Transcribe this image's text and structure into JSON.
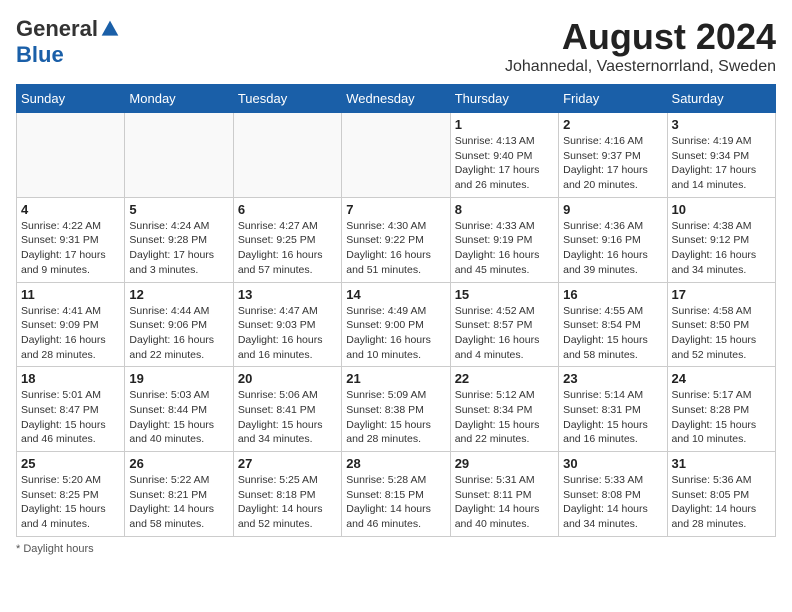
{
  "logo": {
    "general": "General",
    "blue": "Blue"
  },
  "title": {
    "month_year": "August 2024",
    "location": "Johannedal, Vaesternorrland, Sweden"
  },
  "days_of_week": [
    "Sunday",
    "Monday",
    "Tuesday",
    "Wednesday",
    "Thursday",
    "Friday",
    "Saturday"
  ],
  "weeks": [
    {
      "days": [
        {
          "num": "",
          "info": ""
        },
        {
          "num": "",
          "info": ""
        },
        {
          "num": "",
          "info": ""
        },
        {
          "num": "",
          "info": ""
        },
        {
          "num": "1",
          "info": "Sunrise: 4:13 AM\nSunset: 9:40 PM\nDaylight: 17 hours\nand 26 minutes."
        },
        {
          "num": "2",
          "info": "Sunrise: 4:16 AM\nSunset: 9:37 PM\nDaylight: 17 hours\nand 20 minutes."
        },
        {
          "num": "3",
          "info": "Sunrise: 4:19 AM\nSunset: 9:34 PM\nDaylight: 17 hours\nand 14 minutes."
        }
      ]
    },
    {
      "days": [
        {
          "num": "4",
          "info": "Sunrise: 4:22 AM\nSunset: 9:31 PM\nDaylight: 17 hours\nand 9 minutes."
        },
        {
          "num": "5",
          "info": "Sunrise: 4:24 AM\nSunset: 9:28 PM\nDaylight: 17 hours\nand 3 minutes."
        },
        {
          "num": "6",
          "info": "Sunrise: 4:27 AM\nSunset: 9:25 PM\nDaylight: 16 hours\nand 57 minutes."
        },
        {
          "num": "7",
          "info": "Sunrise: 4:30 AM\nSunset: 9:22 PM\nDaylight: 16 hours\nand 51 minutes."
        },
        {
          "num": "8",
          "info": "Sunrise: 4:33 AM\nSunset: 9:19 PM\nDaylight: 16 hours\nand 45 minutes."
        },
        {
          "num": "9",
          "info": "Sunrise: 4:36 AM\nSunset: 9:16 PM\nDaylight: 16 hours\nand 39 minutes."
        },
        {
          "num": "10",
          "info": "Sunrise: 4:38 AM\nSunset: 9:12 PM\nDaylight: 16 hours\nand 34 minutes."
        }
      ]
    },
    {
      "days": [
        {
          "num": "11",
          "info": "Sunrise: 4:41 AM\nSunset: 9:09 PM\nDaylight: 16 hours\nand 28 minutes."
        },
        {
          "num": "12",
          "info": "Sunrise: 4:44 AM\nSunset: 9:06 PM\nDaylight: 16 hours\nand 22 minutes."
        },
        {
          "num": "13",
          "info": "Sunrise: 4:47 AM\nSunset: 9:03 PM\nDaylight: 16 hours\nand 16 minutes."
        },
        {
          "num": "14",
          "info": "Sunrise: 4:49 AM\nSunset: 9:00 PM\nDaylight: 16 hours\nand 10 minutes."
        },
        {
          "num": "15",
          "info": "Sunrise: 4:52 AM\nSunset: 8:57 PM\nDaylight: 16 hours\nand 4 minutes."
        },
        {
          "num": "16",
          "info": "Sunrise: 4:55 AM\nSunset: 8:54 PM\nDaylight: 15 hours\nand 58 minutes."
        },
        {
          "num": "17",
          "info": "Sunrise: 4:58 AM\nSunset: 8:50 PM\nDaylight: 15 hours\nand 52 minutes."
        }
      ]
    },
    {
      "days": [
        {
          "num": "18",
          "info": "Sunrise: 5:01 AM\nSunset: 8:47 PM\nDaylight: 15 hours\nand 46 minutes."
        },
        {
          "num": "19",
          "info": "Sunrise: 5:03 AM\nSunset: 8:44 PM\nDaylight: 15 hours\nand 40 minutes."
        },
        {
          "num": "20",
          "info": "Sunrise: 5:06 AM\nSunset: 8:41 PM\nDaylight: 15 hours\nand 34 minutes."
        },
        {
          "num": "21",
          "info": "Sunrise: 5:09 AM\nSunset: 8:38 PM\nDaylight: 15 hours\nand 28 minutes."
        },
        {
          "num": "22",
          "info": "Sunrise: 5:12 AM\nSunset: 8:34 PM\nDaylight: 15 hours\nand 22 minutes."
        },
        {
          "num": "23",
          "info": "Sunrise: 5:14 AM\nSunset: 8:31 PM\nDaylight: 15 hours\nand 16 minutes."
        },
        {
          "num": "24",
          "info": "Sunrise: 5:17 AM\nSunset: 8:28 PM\nDaylight: 15 hours\nand 10 minutes."
        }
      ]
    },
    {
      "days": [
        {
          "num": "25",
          "info": "Sunrise: 5:20 AM\nSunset: 8:25 PM\nDaylight: 15 hours\nand 4 minutes."
        },
        {
          "num": "26",
          "info": "Sunrise: 5:22 AM\nSunset: 8:21 PM\nDaylight: 14 hours\nand 58 minutes."
        },
        {
          "num": "27",
          "info": "Sunrise: 5:25 AM\nSunset: 8:18 PM\nDaylight: 14 hours\nand 52 minutes."
        },
        {
          "num": "28",
          "info": "Sunrise: 5:28 AM\nSunset: 8:15 PM\nDaylight: 14 hours\nand 46 minutes."
        },
        {
          "num": "29",
          "info": "Sunrise: 5:31 AM\nSunset: 8:11 PM\nDaylight: 14 hours\nand 40 minutes."
        },
        {
          "num": "30",
          "info": "Sunrise: 5:33 AM\nSunset: 8:08 PM\nDaylight: 14 hours\nand 34 minutes."
        },
        {
          "num": "31",
          "info": "Sunrise: 5:36 AM\nSunset: 8:05 PM\nDaylight: 14 hours\nand 28 minutes."
        }
      ]
    }
  ],
  "footer": "Daylight hours"
}
